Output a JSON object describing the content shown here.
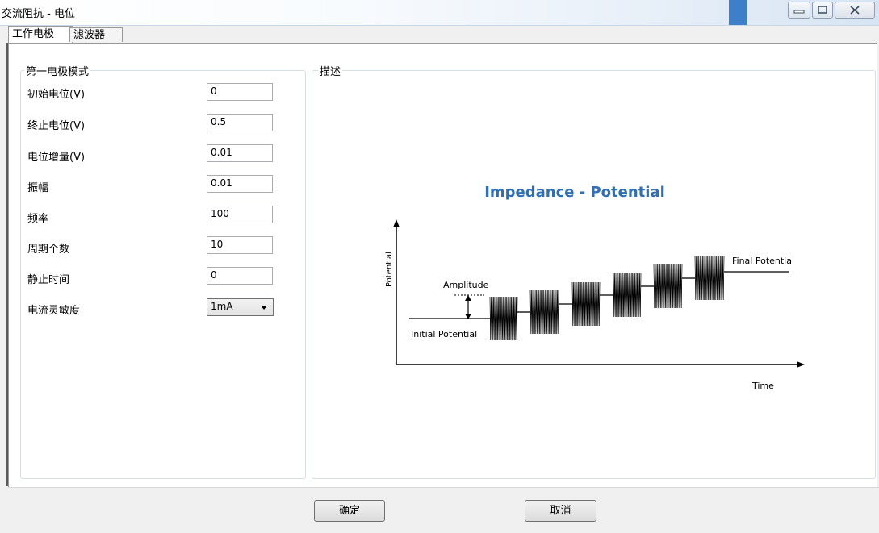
{
  "window": {
    "title": "交流阻抗 - 电位",
    "controls": [
      "minimize-icon",
      "maximize-icon",
      "close-icon"
    ]
  },
  "tabs": [
    {
      "label": "工作电极",
      "active": true
    },
    {
      "label": "滤波器",
      "active": false
    }
  ],
  "left_group": {
    "title": "第一电极模式",
    "fields": [
      {
        "label": "初始电位(V)",
        "value": "0"
      },
      {
        "label": "终止电位(V)",
        "value": "0.5"
      },
      {
        "label": "电位增量(V)",
        "value": "0.01"
      },
      {
        "label": "振幅",
        "value": "0.01"
      },
      {
        "label": "频率",
        "value": "100"
      },
      {
        "label": "周期个数",
        "value": "10"
      },
      {
        "label": "静止时间",
        "value": "0"
      }
    ],
    "sensitivity": {
      "label": "电流灵敏度",
      "selected": "1mA"
    }
  },
  "right_group": {
    "title": "描述",
    "diagram": {
      "title": "Impedance - Potential",
      "y_axis_label": "Potential",
      "x_axis_label": "Time",
      "labels": {
        "amplitude": "Amplitude",
        "initial": "Initial Potential",
        "final": "Final Potential"
      },
      "title_color": "#2f6fb6"
    }
  },
  "buttons": {
    "ok": "确定",
    "cancel": "取消"
  }
}
